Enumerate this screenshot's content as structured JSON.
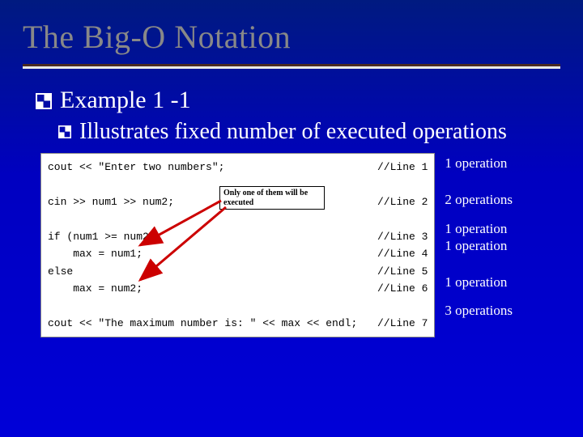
{
  "title": "The Big-O Notation",
  "bullet1": "Example 1 -1",
  "bullet2": "Illustrates fixed number of executed operations",
  "callout": "Only one of them will be executed",
  "code": {
    "l1": {
      "text": "cout << \"Enter two numbers\";",
      "comment": "//Line 1"
    },
    "l2": {
      "text": "cin >> num1 >> num2;",
      "comment": "//Line 2"
    },
    "l3": {
      "text": "if (num1 >= num2)",
      "comment": "//Line 3"
    },
    "l4": {
      "text": "    max = num1;",
      "comment": "//Line 4"
    },
    "l5": {
      "text": "else",
      "comment": "//Line 5"
    },
    "l6": {
      "text": "    max = num2;",
      "comment": "//Line 6"
    },
    "l7": {
      "text": "cout << \"The maximum number is: \" << max << endl;",
      "comment": "//Line 7"
    }
  },
  "ops": {
    "o1": "1  operation",
    "o2": "2  operations",
    "o3": "1  operation",
    "o4": "1  operation",
    "o5": "1  operation",
    "o6": "3  operations"
  }
}
